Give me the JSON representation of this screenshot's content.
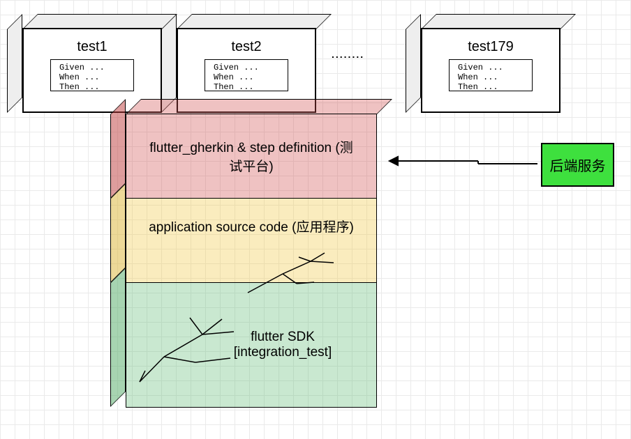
{
  "tests": [
    {
      "name": "test1",
      "code": [
        "Given ...",
        "When ...",
        "Then ..."
      ]
    },
    {
      "name": "test2",
      "code": [
        "Given ...",
        "When ...",
        "Then ..."
      ]
    },
    {
      "name": "test179",
      "code": [
        "Given ...",
        "When ...",
        "Then ..."
      ]
    }
  ],
  "ellipsis": "........",
  "layers": {
    "top": {
      "label": "flutter_gherkin & step definition (测试平台)"
    },
    "middle": {
      "label": "application source code (应用程序)"
    },
    "bottom": {
      "label": "flutter SDK [integration_test]"
    }
  },
  "backend": {
    "label": "后端服务"
  }
}
